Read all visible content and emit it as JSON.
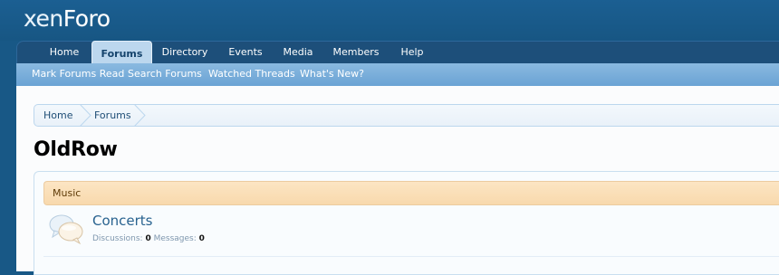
{
  "header": {
    "logo_text_part1": "xen",
    "logo_text_part2": "Foro"
  },
  "nav": {
    "tabs": [
      {
        "label": "Home",
        "selected": false
      },
      {
        "label": "Forums",
        "selected": true
      },
      {
        "label": "Directory",
        "selected": false
      },
      {
        "label": "Events",
        "selected": false
      },
      {
        "label": "Media",
        "selected": false
      },
      {
        "label": "Members",
        "selected": false
      },
      {
        "label": "Help",
        "selected": false
      }
    ]
  },
  "subnav": {
    "links": [
      "Mark Forums Read",
      "Search Forums",
      "Watched Threads",
      "What's New?"
    ]
  },
  "breadcrumb": {
    "items": [
      "Home",
      "Forums"
    ]
  },
  "page": {
    "title": "OldRow"
  },
  "category": {
    "title": "Music"
  },
  "forum": {
    "title": "Concerts",
    "discussions_label": "Discussions:",
    "discussions_value": "0",
    "messages_label": "Messages:",
    "messages_value": "0"
  },
  "colors": {
    "header_bg": "#185886",
    "nav_bg": "#1d4f7a",
    "subnav_bg": "#7eb2de",
    "category_bg": "#fbe0b8",
    "link": "#28628f"
  }
}
